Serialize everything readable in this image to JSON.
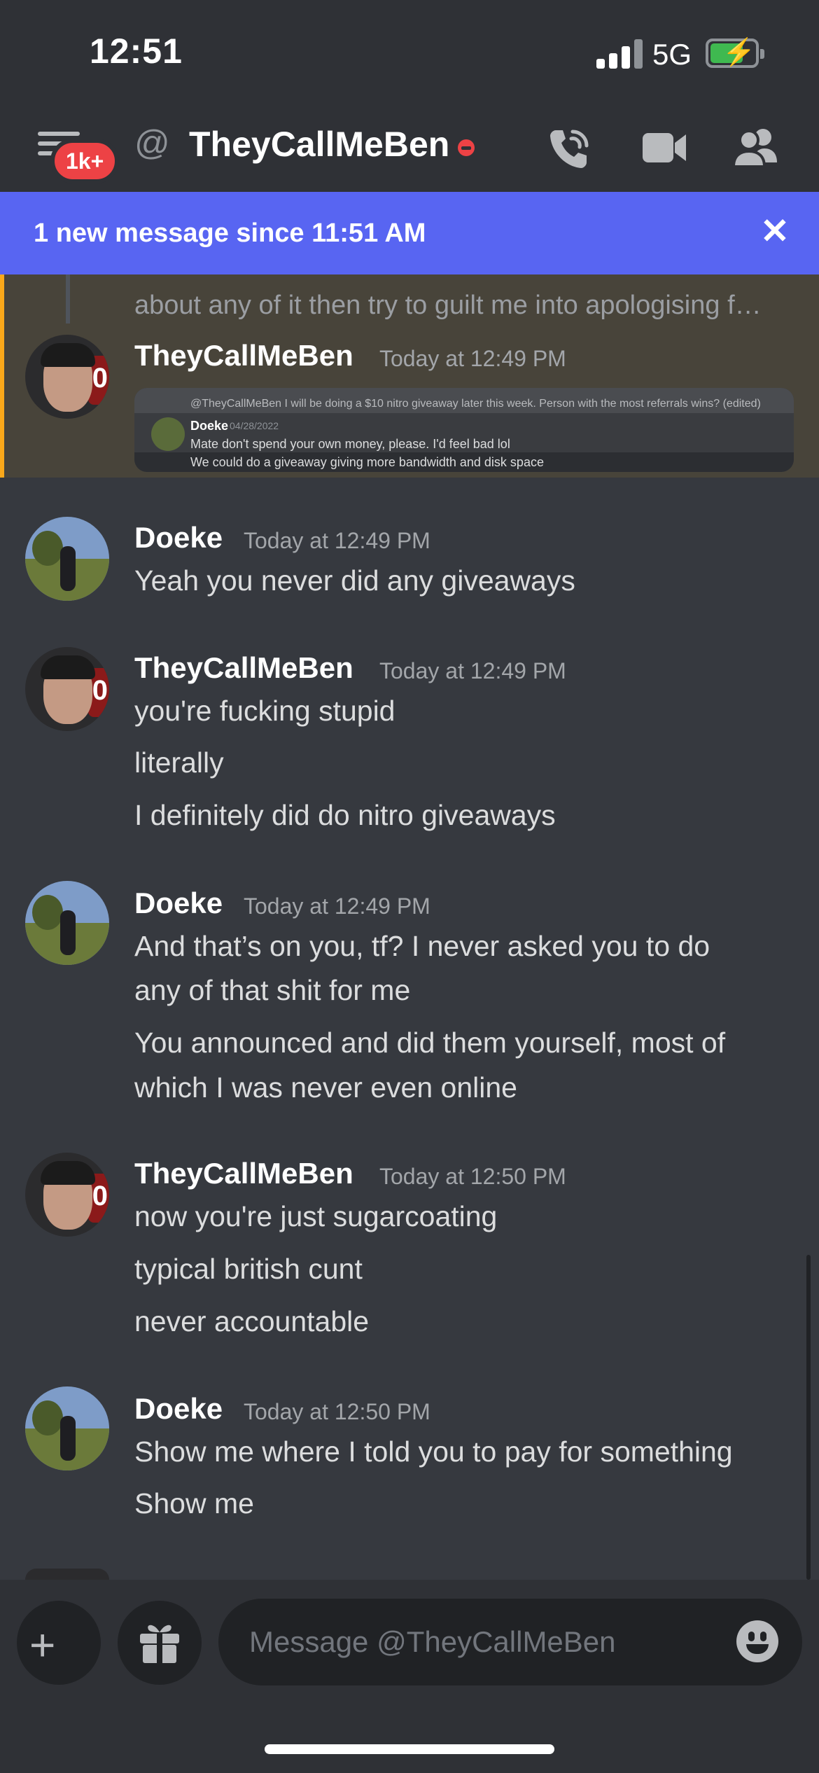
{
  "status_bar": {
    "time": "12:51",
    "network": "5G"
  },
  "header": {
    "unread_badge": "1k+",
    "title": "TheyCallMeBen"
  },
  "new_message_bar": {
    "text": "1 new message since 11:51 AM",
    "close": "✕"
  },
  "highlighted": {
    "reply_text": "about any of it then try to guilt me into apologising f…",
    "author": "TheyCallMeBen",
    "timestamp": "Today at 12:49 PM",
    "embed": {
      "line1": "@TheyCallMeBen I will be doing a $10 nitro giveaway later this week. Person with the most referrals wins? (edited)",
      "name": "Doeke",
      "date": "04/28/2022",
      "line2": "Mate don't spend your own money, please. I'd feel bad lol",
      "line3": "We could do a giveaway giving more bandwidth and disk space"
    }
  },
  "messages": [
    {
      "author": "Doeke",
      "timestamp": "Today at 12:49 PM",
      "lines": [
        "Yeah you never did any giveaways"
      ]
    },
    {
      "author": "TheyCallMeBen",
      "timestamp": "Today at 12:49 PM",
      "lines": [
        "you're fucking stupid",
        "literally",
        "I definitely did do nitro giveaways"
      ]
    },
    {
      "author": "Doeke",
      "timestamp": "Today at 12:49 PM",
      "lines": [
        "And that’s on you, tf? I never asked you to do",
        "any of that shit for me",
        "You announced and did them yourself, most of",
        "which I was never even online"
      ]
    },
    {
      "author": "TheyCallMeBen",
      "timestamp": "Today at 12:50 PM",
      "lines": [
        "now you're just sugarcoating",
        "typical british cunt",
        "never accountable"
      ]
    },
    {
      "author": "Doeke",
      "timestamp": "Today at 12:50 PM",
      "lines": [
        "Show me where I told you to pay for something",
        "Show me"
      ]
    }
  ],
  "composer": {
    "placeholder": "Message @TheyCallMeBen"
  },
  "colors": {
    "background": "#36393f",
    "header": "#2f3136",
    "accent": "#5865f2",
    "mention_bar": "#faa81a",
    "dnd": "#ed4245"
  },
  "icons": [
    "menu-icon",
    "at-icon",
    "call-icon",
    "video-icon",
    "members-icon",
    "close-icon",
    "plus-icon",
    "gift-icon",
    "emoji-icon"
  ]
}
